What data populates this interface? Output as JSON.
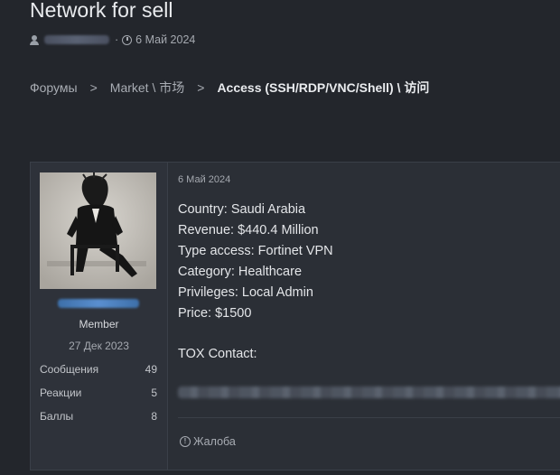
{
  "thread": {
    "title": "Network for sell",
    "date": "6 Май 2024"
  },
  "breadcrumb": {
    "items": [
      "Форумы",
      "Market \\ 市场",
      "Access (SSH/RDP/VNC/Shell) \\ 访问"
    ],
    "separator": ">"
  },
  "post": {
    "date": "6 Май 2024",
    "lines": [
      "Country: Saudi Arabia",
      "Revenue: $440.4 Million",
      "Type access: Fortinet VPN",
      "Category: Healthcare",
      "Privileges: Local Admin",
      "Price: $1500"
    ],
    "tox_label": "TOX Contact:",
    "report_label": "Жалоба"
  },
  "user": {
    "role": "Member",
    "joined": "27 Дек 2023",
    "stats": [
      {
        "label": "Сообщения",
        "value": "49"
      },
      {
        "label": "Реакции",
        "value": "5"
      },
      {
        "label": "Баллы",
        "value": "8"
      }
    ]
  },
  "icons": {
    "user": "user-icon",
    "clock": "clock-icon",
    "report": "report-icon"
  },
  "colors": {
    "background": "#23262c",
    "panel": "#2b2f36",
    "text": "#e4e6e9",
    "muted": "#a5a9b0"
  }
}
